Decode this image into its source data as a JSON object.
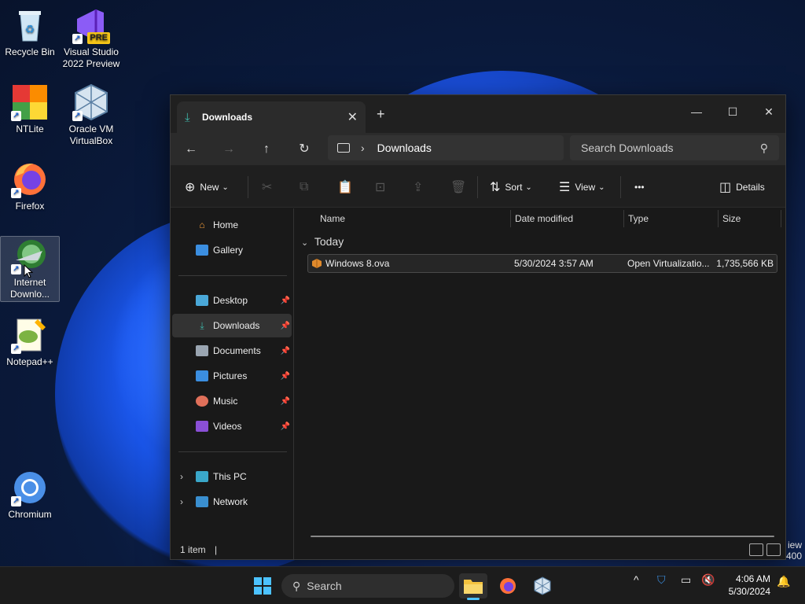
{
  "desktop": {
    "icons": [
      {
        "label": "Recycle Bin"
      },
      {
        "label": "Visual Studio 2022 Preview",
        "badge": "PRE"
      },
      {
        "label": "NTLite"
      },
      {
        "label": "Oracle VM VirtualBox"
      },
      {
        "label": "Firefox"
      },
      {
        "label": "Internet Downlo..."
      },
      {
        "label": "Notepad++"
      },
      {
        "label": "Chromium"
      }
    ],
    "watermark_line1": "iew",
    "watermark_line2": "400"
  },
  "window": {
    "tab_title": "Downloads",
    "address": {
      "path": "Downloads"
    },
    "search": {
      "placeholder": "Search Downloads"
    },
    "toolbar": {
      "new_label": "New",
      "sort_label": "Sort",
      "view_label": "View",
      "more_label": "•••",
      "details_label": "Details"
    },
    "sidebar": {
      "top": [
        {
          "label": "Home"
        },
        {
          "label": "Gallery"
        }
      ],
      "pinned": [
        {
          "label": "Desktop"
        },
        {
          "label": "Downloads"
        },
        {
          "label": "Documents"
        },
        {
          "label": "Pictures"
        },
        {
          "label": "Music"
        },
        {
          "label": "Videos"
        }
      ],
      "bottom": [
        {
          "label": "This PC"
        },
        {
          "label": "Network"
        }
      ]
    },
    "columns": [
      "Name",
      "Date modified",
      "Type",
      "Size"
    ],
    "group_label": "Today",
    "files": [
      {
        "name": "Windows 8.ova",
        "date": "5/30/2024 3:57 AM",
        "type": "Open Virtualizatio...",
        "size": "1,735,566 KB"
      }
    ],
    "status": {
      "count": "1 item"
    }
  },
  "taskbar": {
    "search_label": "Search",
    "clock": {
      "time": "4:06 AM",
      "date": "5/30/2024"
    }
  }
}
